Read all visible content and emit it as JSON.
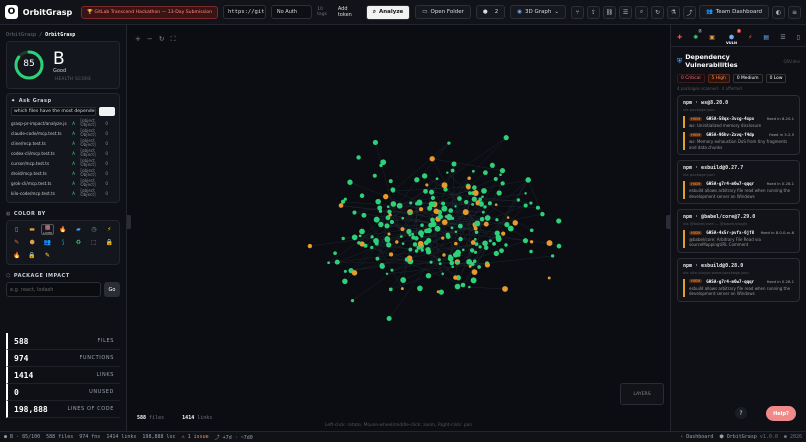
{
  "topbar": {
    "logo_letter": "O",
    "brand": "OrbitGrasp",
    "hackathon_badge": "GitLab Transcend Hackathon — 13-Day Submission",
    "url_value": "https://gitl",
    "auth_select": "No Auth",
    "token_label": "10 tags",
    "add_token": "Add token",
    "analyze": "Analyze",
    "open_folder": "Open Folder",
    "count": "2",
    "graph_mode": "3D Graph",
    "team_dashboard": "Team Dashboard"
  },
  "left": {
    "repo_prefix": "OrbitGrasp /",
    "repo_name": "OrbitGrasp",
    "health_score": "85",
    "grade": "B",
    "grade_label": "Good",
    "health_label": "HEALTH SCORE",
    "ask_title": "Ask Grasp",
    "ask_value": "which files have the most dependen",
    "ask_rows": [
      {
        "file": "grasp-pr-impact/analyze.js",
        "grade": "A",
        "obj": "[object Object]",
        "n": "0"
      },
      {
        "file": "claude-code/mcp.test.ts",
        "grade": "A",
        "obj": "[object Object]",
        "n": "0"
      },
      {
        "file": "cline/mcp.test.ts",
        "grade": "A",
        "obj": "[object Object]",
        "n": "0"
      },
      {
        "file": "codex-cli/mcp.test.ts",
        "grade": "A",
        "obj": "[object Object]",
        "n": "0"
      },
      {
        "file": "cursor/mcp.test.ts",
        "grade": "A",
        "obj": "[object Object]",
        "n": "0"
      },
      {
        "file": "droid/mcp.test.ts",
        "grade": "A",
        "obj": "[object Object]",
        "n": "0"
      },
      {
        "file": "grok-cli/mcp.test.ts",
        "grade": "A",
        "obj": "[object Object]",
        "n": "0"
      },
      {
        "file": "kilo-code/mcp.test.ts",
        "grade": "A",
        "obj": "[object Object]",
        "n": "0"
      }
    ],
    "color_by": "COLOR BY",
    "layer_label": "LAYER",
    "pkg_title": "PACKAGE IMPACT",
    "pkg_placeholder": "e.g. react, lodash",
    "go": "Go",
    "stats": [
      {
        "n": "588",
        "l": "FILES"
      },
      {
        "n": "974",
        "l": "FUNCTIONS"
      },
      {
        "n": "1414",
        "l": "LINKS"
      },
      {
        "n": "0",
        "l": "UNUSED"
      },
      {
        "n": "198,888",
        "l": "LINES OF CODE"
      }
    ]
  },
  "canvas": {
    "files_count": "588",
    "files_label": "files",
    "links_count": "1414",
    "links_label": "links",
    "layers_btn": "LAYERS",
    "hint": "Left-click: rotate, Mouse-wheel/middle-click: zoom, Right-click: pan",
    "help": "Help?"
  },
  "right": {
    "vuln_tab": "VULN",
    "title": "Dependency Vulnerabilities",
    "title_tag": "OSV.dev",
    "critical": "0 Critical",
    "high": "5 High",
    "medium": "0 Medium",
    "low": "0 Low",
    "summary": "4 packages scanned · 4 affected",
    "vulns": [
      {
        "pkg": "npm · ws@8.20.0",
        "via": "via package.json",
        "advs": [
          {
            "sev": "HIGH",
            "id": "GHSA-58qx-3vcg-4xpx",
            "fix": "fixed in 8.20.1",
            "desc": "ws: Uninitialized memory disclosure"
          },
          {
            "sev": "HIGH",
            "id": "GHSA-96hv-2xvq-f4dp",
            "fix": "fixed in 5.2.5",
            "desc": "ws: Memory exhaustion DoS from tiny fragments and data chunks"
          }
        ]
      },
      {
        "pkg": "npm · esbuild@0.27.7",
        "via": "via package.json",
        "advs": [
          {
            "sev": "HIGH",
            "id": "GHSA-g7r4-m6w7-qqqr",
            "fix": "fixed in 0.28.1",
            "desc": "esbuild allows arbitrary file read when running the development server on Windows"
          }
        ]
      },
      {
        "pkg": "npm · @babel/core@7.29.0",
        "via": "via @babel/core — @babel/plugin",
        "advs": [
          {
            "sev": "HIGH",
            "id": "GHSA-4x5r-pvfx-6jf8",
            "fix": "fixed in 8.0.0-rc.6",
            "desc": "@babel/core: Arbitrary File Read via sourceMappingURL Comment"
          }
        ]
      },
      {
        "pkg": "npm · esbuild@0.28.0",
        "via": "via vite-plugin-wasm/package.json",
        "advs": [
          {
            "sev": "HIGH",
            "id": "GHSA-g7r4-m6w7-qqqr",
            "fix": "fixed in 0.28.1",
            "desc": "esbuild allows arbitrary file read when running the development server on Windows"
          }
        ]
      }
    ]
  },
  "status": {
    "grade": "B · 85/100",
    "files": "588 files",
    "fns": "974 fns",
    "links": "1414 links",
    "loc": "198,888 loc",
    "issue": "1 issue",
    "delta": "+7d · ~7d0",
    "dashboard": "Dashboard",
    "app": "OrbitGrasp",
    "version": "v1.0.0",
    "year": "2026"
  },
  "colors": {
    "accent_green": "#2fd07a",
    "accent_orange": "#e89a2c",
    "bg": "#0b0d12"
  }
}
